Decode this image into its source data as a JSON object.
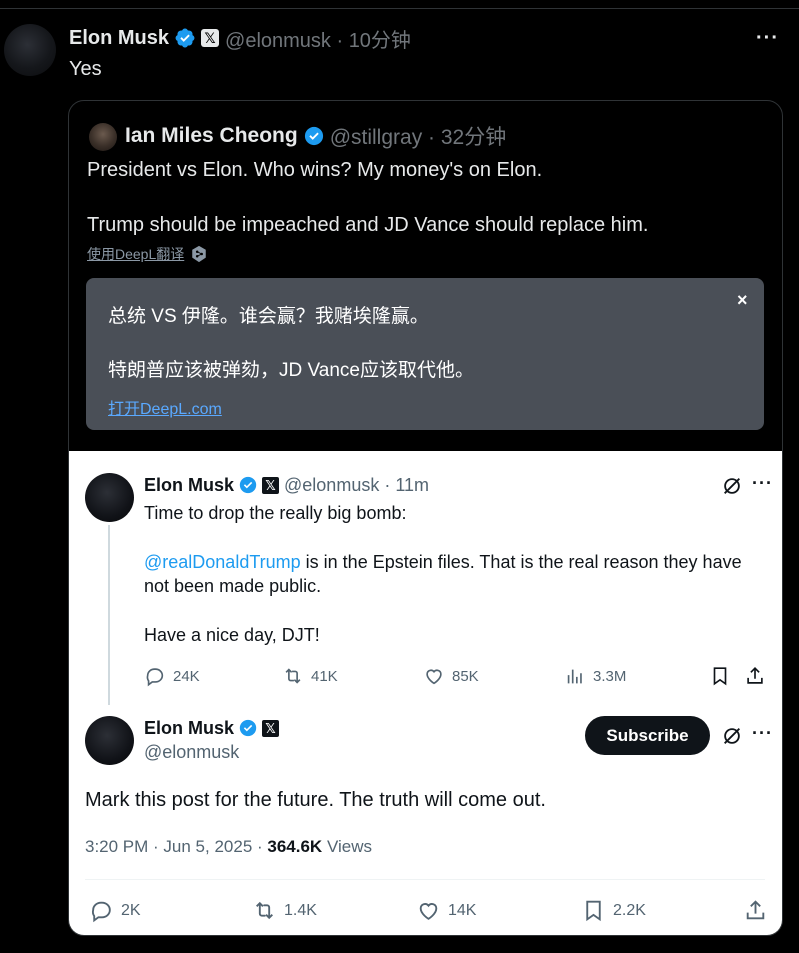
{
  "outer_post": {
    "author_name": "Elon Musk",
    "x_badge": "𝕏",
    "handle_time": "@elonmusk · 10分钟",
    "text": "Yes",
    "more": "···"
  },
  "quoted_post": {
    "author_name": "Ian Miles Cheong",
    "handle_time": "@stillgray · 32分钟",
    "line1": "President vs Elon. Who wins? My money's on Elon.",
    "line2": "Trump should be impeached and JD Vance should replace him.",
    "translate_link": "使用DeepL翻译"
  },
  "translation_popup": {
    "close": "×",
    "line1": "总统 VS 伊隆。谁会赢？我赌埃隆赢。",
    "line2": "特朗普应该被弹劾，JD Vance应该取代他。",
    "link": "打开DeepL.com"
  },
  "screenshot": {
    "post1": {
      "author_name": "Elon Musk",
      "x_badge": "𝕏",
      "handle_time": "@elonmusk · 11m",
      "more": "···",
      "line1": "Time to drop the really big bomb:",
      "mention": "@realDonaldTrump",
      "line2_rest": " is in the Epstein files. That is the real reason they have",
      "line3": "not been made public.",
      "line4": "Have a nice day, DJT!",
      "replies": "24K",
      "reposts": "41K",
      "likes": "85K",
      "views": "3.3M"
    },
    "post2": {
      "author_name": "Elon Musk",
      "x_badge": "𝕏",
      "handle": "@elonmusk",
      "subscribe": "Subscribe",
      "more": "···",
      "text": "Mark this post for the future. The truth will come out.",
      "time_date": "3:20 PM · Jun 5, 2025 · ",
      "views_count": "364.6K",
      "views_label": " Views",
      "replies": "2K",
      "reposts": "1.4K",
      "likes": "14K",
      "bookmarks": "2.2K"
    }
  },
  "colors": {
    "accent_blue": "#1d9bf0",
    "dark_bg": "#000000",
    "popup_bg": "#4a4f57",
    "link_blue": "#5aa9ff"
  }
}
